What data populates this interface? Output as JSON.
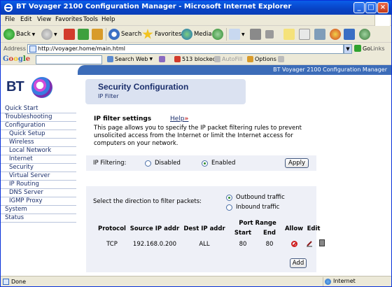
{
  "window": {
    "title": "BT Voyager 2100 Configuration Manager - Microsoft Internet Explorer"
  },
  "menu": [
    "File",
    "Edit",
    "View",
    "Favorites",
    "Tools",
    "Help"
  ],
  "toolbar": {
    "back": "Back",
    "search": "Search",
    "favorites": "Favorites",
    "media": "Media"
  },
  "address": {
    "label": "Address",
    "url": "http://voyager.home/main.html",
    "go": "Go",
    "links": "Links"
  },
  "googlebar": {
    "brand": "Google",
    "search_web": "Search Web",
    "blocked": "513 blocked",
    "autofill": "AutoFill",
    "options": "Options"
  },
  "banner": "BT Voyager 2100 Configuration Manager",
  "logo": "BT",
  "nav": {
    "items": [
      {
        "label": "Quick Start",
        "level": "top"
      },
      {
        "label": "Troubleshooting",
        "level": "top"
      },
      {
        "label": "Configuration",
        "level": "top"
      },
      {
        "label": "Quick Setup",
        "level": "sub"
      },
      {
        "label": "Wireless",
        "level": "sub"
      },
      {
        "label": "Local Network",
        "level": "sub"
      },
      {
        "label": "Internet",
        "level": "sub"
      },
      {
        "label": "Security",
        "level": "sub"
      },
      {
        "label": "Virtual Server",
        "level": "sub"
      },
      {
        "label": "IP Routing",
        "level": "sub"
      },
      {
        "label": "DNS Server",
        "level": "sub"
      },
      {
        "label": "IGMP Proxy",
        "level": "sub"
      },
      {
        "label": "System",
        "level": "top"
      },
      {
        "label": "Status",
        "level": "top"
      }
    ]
  },
  "page": {
    "title": "Security Configuration",
    "subtitle": "IP Filter",
    "section_title": "IP filter settings",
    "help": "Help",
    "help_arrows": "»",
    "description": "This page allows you to specify the IP packet filtering rules to prevent unsolicited access from the Internet or limit the Internet access for computers on your network."
  },
  "filtering": {
    "label": "IP Filtering:",
    "disabled": "Disabled",
    "enabled": "Enabled",
    "selected": "Enabled",
    "apply": "Apply"
  },
  "direction": {
    "label": "Select the direction to filter packets:",
    "outbound": "Outbound traffic",
    "inbound": "Inbound traffic",
    "selected": "Outbound traffic"
  },
  "table": {
    "headers": {
      "protocol": "Protocol",
      "source": "Source IP addr",
      "dest": "Dest IP addr",
      "port_range": "Port Range",
      "start": "Start",
      "end": "End",
      "allow": "Allow",
      "edit": "Edit"
    },
    "rows": [
      {
        "protocol": "TCP",
        "source": "192.168.0.200",
        "dest": "ALL",
        "start": "80",
        "end": "80"
      }
    ],
    "add": "Add"
  },
  "status": {
    "text": "Done",
    "zone": "Internet"
  },
  "colors": {
    "brand_navy": "#1b2f6c",
    "banner_blue": "#3c6cb8",
    "panel": "#eef0f7"
  }
}
